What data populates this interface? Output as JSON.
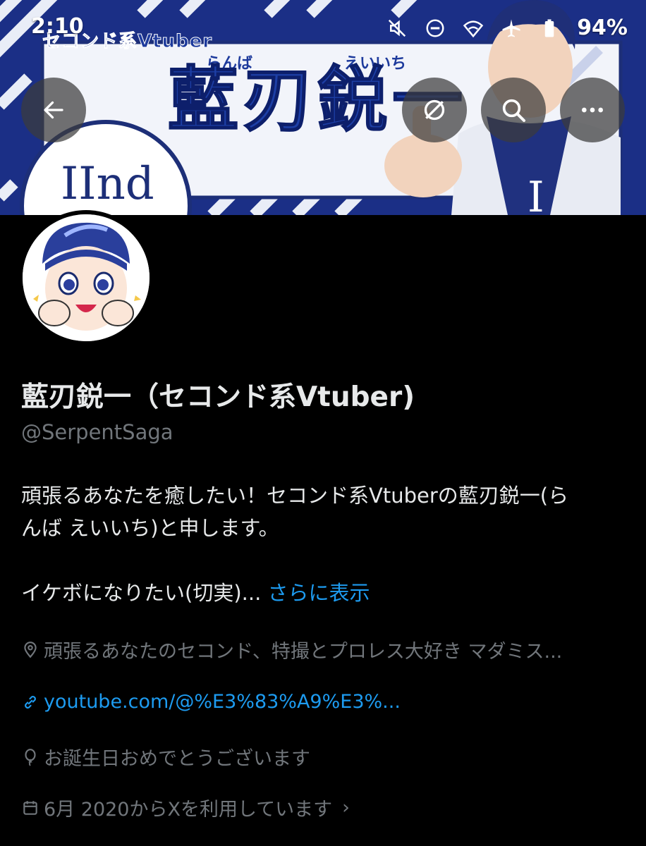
{
  "status_bar": {
    "time": "2:10",
    "battery": "94%",
    "icons": [
      "mute-icon",
      "dnd-icon",
      "wifi-icon",
      "airplane-icon",
      "battery-icon"
    ]
  },
  "banner": {
    "small_text": "セコンド系Vtuber",
    "furigana_1": "らんば",
    "furigana_2": "えいいち",
    "title": "藍刃鋭一",
    "badge_text": "IInd"
  },
  "header_buttons": [
    "back-icon",
    "unmute-icon",
    "search-icon",
    "more-icon"
  ],
  "profile": {
    "display_name": "藍刃鋭一（セコンド系Vtuber)",
    "handle": "@SerpentSaga",
    "bio_line1": "頑張るあなたを癒したい！セコンド系Vtuberの藍刃鋭一(ら",
    "bio_line2": "んば えいいち)と申します。",
    "bio_line3": "イケボになりたい(切実)...",
    "show_more": "さらに表示",
    "location": "頑張るあなたのセコンド、特撮とプロレス大好き マダミス...",
    "url": "youtube.com/@%E3%83%A9%E3%...",
    "birthday": "お誕生日おめでとうございます",
    "joined": "6月 2020からXを利用しています",
    "joined_chevron": "›"
  },
  "colors": {
    "background": "#000000",
    "text_primary": "#e7e9ea",
    "text_secondary": "#71767b",
    "accent": "#1d9bf0",
    "banner_blue": "#1d3fa6"
  }
}
